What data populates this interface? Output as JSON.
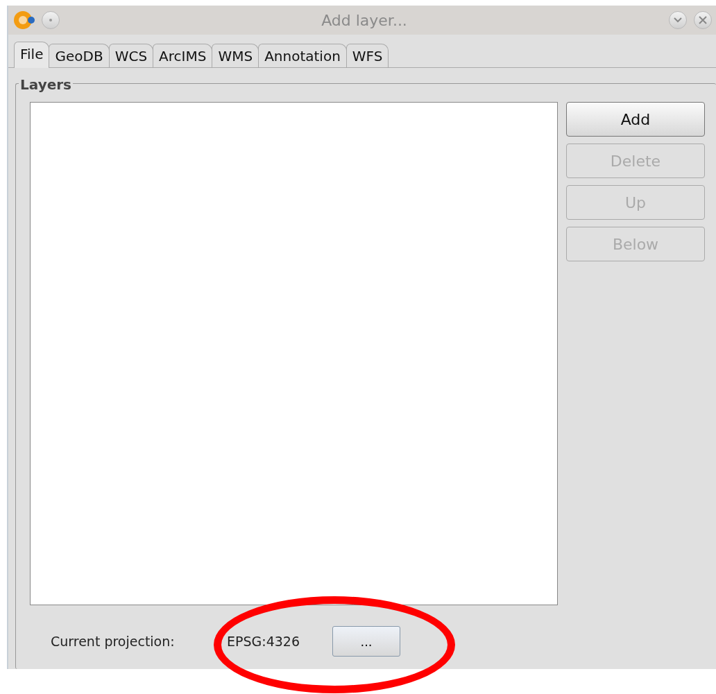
{
  "window": {
    "title": "Add layer..."
  },
  "tabs": [
    {
      "label": "File",
      "selected": true
    },
    {
      "label": "GeoDB",
      "selected": false
    },
    {
      "label": "WCS",
      "selected": false
    },
    {
      "label": "ArcIMS",
      "selected": false
    },
    {
      "label": "WMS",
      "selected": false
    },
    {
      "label": "Annotation",
      "selected": false
    },
    {
      "label": "WFS",
      "selected": false
    }
  ],
  "layers_group": {
    "title": "Layers"
  },
  "buttons": [
    {
      "label": "Add",
      "disabled": false
    },
    {
      "label": "Delete",
      "disabled": true
    },
    {
      "label": "Up",
      "disabled": true
    },
    {
      "label": "Below",
      "disabled": true
    }
  ],
  "projection": {
    "label": "Current projection:",
    "value": "EPSG:4326",
    "button": "..."
  },
  "annotations": [
    {
      "kind": "ellipse"
    }
  ]
}
